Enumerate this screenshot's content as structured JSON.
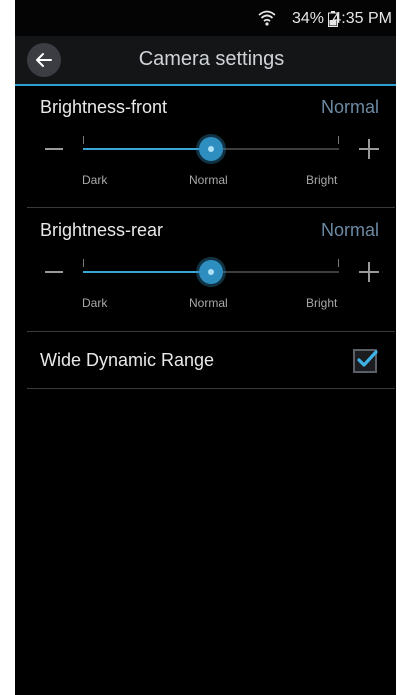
{
  "status": {
    "battery": "34%",
    "time": "4:35 PM"
  },
  "header": {
    "title": "Camera settings"
  },
  "settings": [
    {
      "label": "Brightness-front",
      "value": "Normal",
      "level": 0.5,
      "scale": [
        "Dark",
        "Normal",
        "Bright"
      ]
    },
    {
      "label": "Brightness-rear",
      "value": "Normal",
      "level": 0.5,
      "scale": [
        "Dark",
        "Normal",
        "Bright"
      ]
    }
  ],
  "wdr": {
    "label": "Wide Dynamic Range",
    "checked": true
  },
  "colors": {
    "accent": "#2fa0cf",
    "value_text": "#6d8aa3"
  },
  "icons": {
    "back": "arrow-left-icon",
    "wifi": "wifi-icon",
    "battery": "battery-icon",
    "check": "checkmark-icon"
  }
}
